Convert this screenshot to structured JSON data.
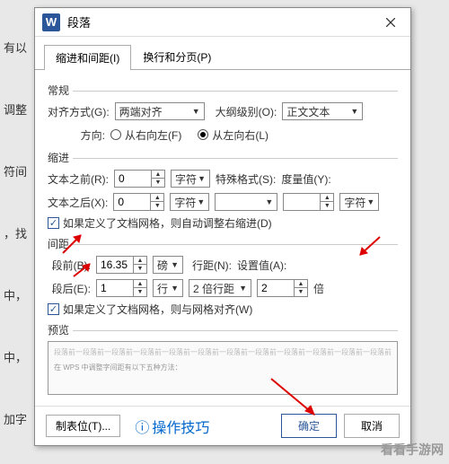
{
  "bg_snippets": [
    "有以",
    "调整",
    "符间",
    "，找",
    "中，",
    "中，",
    "加字"
  ],
  "dialog": {
    "title": "段落",
    "tabs": {
      "indent": "缩进和间距(I)",
      "pagination": "换行和分页(P)"
    },
    "general": {
      "group": "常规",
      "alignment_label": "对齐方式(G):",
      "alignment_value": "两端对齐",
      "outline_label": "大纲级别(O):",
      "outline_value": "正文文本",
      "direction_label": "方向:",
      "rtl_label": "从右向左(F)",
      "ltr_label": "从左向右(L)"
    },
    "indent": {
      "group": "缩进",
      "before_label": "文本之前(R):",
      "before_value": "0",
      "before_unit": "字符",
      "special_label": "特殊格式(S):",
      "special_value": "",
      "measure_label": "度量值(Y):",
      "after_label": "文本之后(X):",
      "after_value": "0",
      "after_unit": "字符",
      "measure_unit": "字符",
      "auto_adjust": "如果定义了文档网格，则自动调整右缩进(D)"
    },
    "spacing": {
      "group": "间距",
      "before_para_label": "段前(B):",
      "before_para_value": "16.35",
      "before_para_unit": "磅",
      "line_spacing_label": "行距(N):",
      "line_spacing_value": "2 倍行距",
      "set_value_label": "设置值(A):",
      "after_para_label": "段后(E):",
      "after_para_value": "1",
      "after_para_unit": "行",
      "set_value": "2",
      "set_value_unit": "倍",
      "grid_align": "如果定义了文档网格，则与网格对齐(W)"
    },
    "preview": {
      "group": "预览",
      "text1": "段落前一段落前一段落前一段落前一段落前一段落前一段落前一段落前一段落前一段落前一段落前一段落前",
      "text2": "在 WPS 中调整字间距有以下五种方法："
    },
    "footer": {
      "tabstops": "制表位(T)...",
      "tips": "操作技巧",
      "ok": "确定",
      "cancel": "取消"
    }
  },
  "watermark": "看看手游网"
}
